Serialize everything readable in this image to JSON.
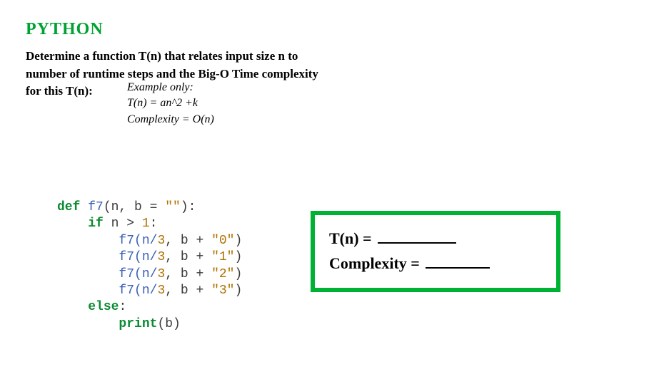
{
  "heading": "PYTHON",
  "prompt_line1": "Determine a function T(n) that relates input size n to",
  "prompt_line2": "number of runtime steps and the Big-O Time complexity",
  "prompt_line3": "for this T(n):",
  "example": {
    "caption": "Example only:",
    "tn": "T(n) = an^2 +k",
    "cx": "Complexity = O(n)"
  },
  "code": {
    "def": "def",
    "fname": "f7",
    "open": "(n, b = ",
    "defstr": "\"\"",
    "close": "):",
    "if_kw": "if",
    "cond_a": " n ",
    "gt": ">",
    "cond_b": " ",
    "one": "1",
    "colon": ":",
    "call_pre": "f7(n/",
    "three": "3",
    "call_mid": ", b + ",
    "s0": "\"0\"",
    "s1": "\"1\"",
    "s2": "\"2\"",
    "s3": "\"3\"",
    "call_end": ")",
    "else_kw": "else",
    "print_kw": "print",
    "print_arg": "(b)"
  },
  "answer": {
    "tn_label": "T(n) =",
    "cx_label": "Complexity ="
  }
}
